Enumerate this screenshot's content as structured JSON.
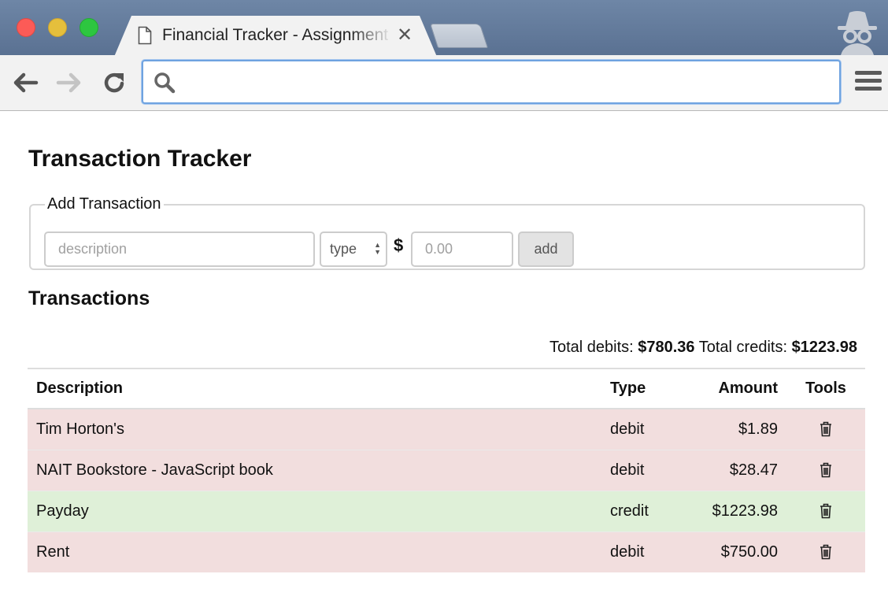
{
  "browser": {
    "tab_title": "Financial Tracker - Assignment",
    "tab_close": "✕",
    "address_value": "",
    "address_placeholder": ""
  },
  "page": {
    "title": "Transaction Tracker",
    "form": {
      "legend": "Add Transaction",
      "description_placeholder": "description",
      "description_value": "",
      "type_selected": "type",
      "currency_symbol": "$",
      "amount_placeholder": "0.00",
      "amount_value": "",
      "add_label": "add"
    },
    "transactions_heading": "Transactions",
    "totals": {
      "debits_label": "Total debits:",
      "debits_value": "$780.36",
      "credits_label": "Total credits:",
      "credits_value": "$1223.98"
    },
    "table": {
      "headers": [
        "Description",
        "Type",
        "Amount",
        "Tools"
      ],
      "rows": [
        {
          "description": "Tim Horton's",
          "type": "debit",
          "amount": "$1.89"
        },
        {
          "description": "NAIT Bookstore - JavaScript book",
          "type": "debit",
          "amount": "$28.47"
        },
        {
          "description": "Payday",
          "type": "credit",
          "amount": "$1223.98"
        },
        {
          "description": "Rent",
          "type": "debit",
          "amount": "$750.00"
        }
      ]
    }
  },
  "colors": {
    "debit_row": "#f2dede",
    "credit_row": "#dff0d8",
    "titlebar": "#6680a1",
    "focus_ring": "#6fa3e0"
  },
  "icons": {
    "tab": "document-icon",
    "back": "back-arrow-icon",
    "forward": "forward-arrow-icon",
    "reload": "reload-icon",
    "search": "search-icon",
    "menu": "hamburger-menu-icon",
    "incognito": "incognito-icon",
    "delete": "trash-icon"
  }
}
